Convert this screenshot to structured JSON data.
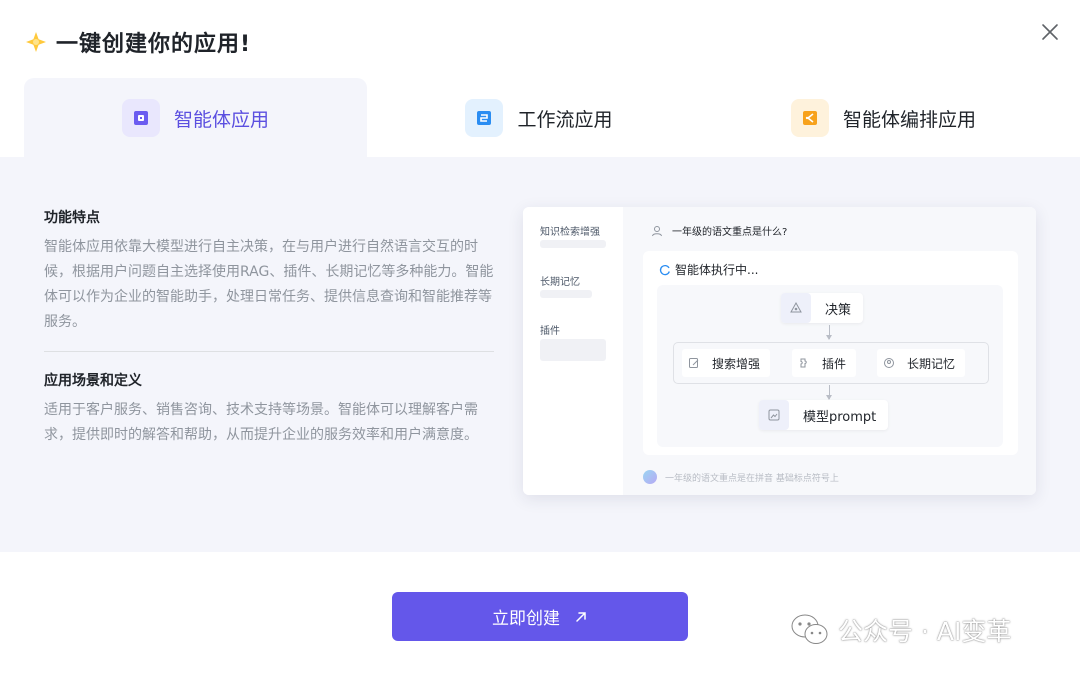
{
  "dialog": {
    "title": "一键创建你的应用!",
    "close_icon": "close-icon"
  },
  "tabs": [
    {
      "label": "智能体应用",
      "icon": "agent-app-icon",
      "icon_color": "#6b5cf0",
      "active": true
    },
    {
      "label": "工作流应用",
      "icon": "workflow-app-icon",
      "icon_color": "#2a8df2",
      "active": false
    },
    {
      "label": "智能体编排应用",
      "icon": "agent-orchestration-icon",
      "icon_color": "#f7a21c",
      "active": false
    }
  ],
  "features": {
    "title": "功能特点",
    "body": "智能体应用依靠大模型进行自主决策，在与用户进行自然语言交互的时候，根据用户问题自主选择使用RAG、插件、长期记忆等多种能力。智能体可以作为企业的智能助手，处理日常任务、提供信息查询和智能推荐等服务。"
  },
  "scenarios": {
    "title": "应用场景和定义",
    "body": "适用于客户服务、销售咨询、技术支持等场景。智能体可以理解客户需求，提供即时的解答和帮助，从而提升企业的服务效率和用户满意度。"
  },
  "preview": {
    "sidebar": [
      "知识检索增强",
      "长期记忆",
      "插件"
    ],
    "question": "一年级的语文重点是什么?",
    "status": "智能体执行中...",
    "flow": {
      "decision": "决策",
      "tools": [
        "搜索增强",
        "插件",
        "长期记忆"
      ],
      "model": "模型prompt"
    },
    "input_hint": "一年级的语文重点是在拼音  基础标点符号上"
  },
  "cta": {
    "label": "立即创建"
  },
  "watermark": {
    "text": "公众号 · AI变革"
  },
  "colors": {
    "accent": "#6457ea",
    "panel_bg": "#f4f5fb"
  }
}
